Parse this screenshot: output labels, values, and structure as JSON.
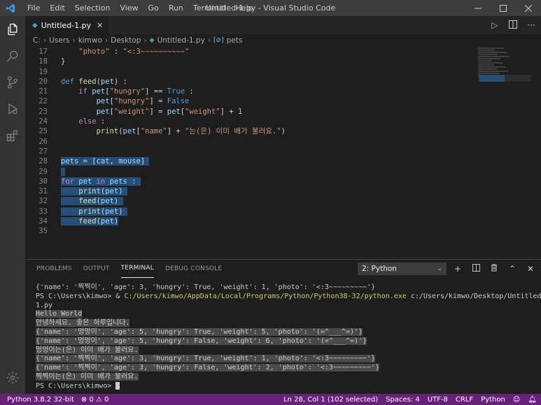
{
  "titlebar": {
    "menu": [
      "File",
      "Edit",
      "Selection",
      "View",
      "Go",
      "Run",
      "Terminal",
      "Help"
    ],
    "window_title": "Untitled-1.py - Visual Studio Code"
  },
  "tab": {
    "label": "Untitled-1.py"
  },
  "breadcrumb": [
    "C:",
    "Users",
    "kimwo",
    "Desktop",
    "Untitled-1.py",
    "pets"
  ],
  "editor": {
    "lines": [
      {
        "n": "17",
        "html": "<span class='st'>    \"photo\"</span> : <span class='st'>\"&lt;:3~~~~~~~~~~\"</span>"
      },
      {
        "n": "18",
        "html": "}"
      },
      {
        "n": "19",
        "html": ""
      },
      {
        "n": "20",
        "html": "<span class='kw'>def</span> <span class='fn'>feed</span>(<span class='var'>pet</span>) :"
      },
      {
        "n": "21",
        "html": "    <span class='kw2'>if</span> <span class='var'>pet</span>[<span class='st'>\"hungry\"</span>] == <span class='kw'>True</span> :"
      },
      {
        "n": "22",
        "html": "        <span class='var'>pet</span>[<span class='st'>\"hungry\"</span>] = <span class='kw'>False</span>"
      },
      {
        "n": "23",
        "html": "        <span class='var'>pet</span>[<span class='st'>\"weight\"</span>] = <span class='var'>pet</span>[<span class='st'>\"weight\"</span>] + <span class='num'>1</span>"
      },
      {
        "n": "24",
        "html": "    <span class='kw2'>else</span> :"
      },
      {
        "n": "25",
        "html": "        <span class='fn'>print</span>(<span class='var'>pet</span>[<span class='st'>\"name\"</span>] + <span class='st'>\"는(은) 이미 배가 불러요.\"</span>)"
      },
      {
        "n": "26",
        "html": ""
      },
      {
        "n": "27",
        "html": ""
      },
      {
        "n": "28",
        "html": "<span class='sel'><span class='var'>pets</span> = [<span class='var'>cat</span>, <span class='var'>mouse</span>] </span>"
      },
      {
        "n": "29",
        "html": "<span class='sel'> </span>"
      },
      {
        "n": "30",
        "html": "<span class='sel'><span class='kw2'>for</span> <span class='var'>pet</span> <span class='kw2'>in</span> <span class='var'>pets</span> : </span>"
      },
      {
        "n": "31",
        "html": "<span class='sel'><span class='ws'>····</span><span class='fn'>print</span>(<span class='var'>pet</span>) </span>"
      },
      {
        "n": "32",
        "html": "<span class='sel'><span class='ws'>····</span><span class='fn'>feed</span>(<span class='var'>pet</span>) </span>"
      },
      {
        "n": "33",
        "html": "<span class='sel'><span class='ws'>····</span><span class='fn'>print</span>(<span class='var'>pet</span>) </span>"
      },
      {
        "n": "34",
        "html": "<span class='sel'><span class='ws'>····</span><span class='fn'>feed</span>(<span class='var'>pet</span>)</span>"
      },
      {
        "n": "35",
        "html": ""
      }
    ]
  },
  "panel": {
    "tabs": [
      "PROBLEMS",
      "OUTPUT",
      "TERMINAL",
      "DEBUG CONSOLE"
    ],
    "active_tab": "TERMINAL",
    "terminal_select": "2: Python"
  },
  "terminal": {
    "lines": [
      {
        "text": "{'name': '찍찍이', 'age': 3, 'hungry': True, 'weight': 1, 'photo': '<:3~~~~~~~~~'}",
        "sel": false
      },
      {
        "prompt": "PS C:\\Users\\kimwo> & ",
        "path": "C:/Users/kimwo/AppData/Local/Programs/Python/Python38-32/python.exe",
        "rest": " c:/Users/kimwo/Desktop/Untitled-",
        "sel": false
      },
      {
        "text": "1.py",
        "sel": false
      },
      {
        "text": "Hello World",
        "sel": true
      },
      {
        "text": "안녕하세요. 좋은 하루입니다.",
        "sel": true
      },
      {
        "text": "{'name': '멍멍이', 'age': 5, 'hungry': True, 'weight': 5, 'photo': '(=^___^=)'}",
        "sel": true
      },
      {
        "text": "{'name': '멍멍이', 'age': 5, 'hungry': False, 'weight': 6, 'photo': '(=^___^=)'}",
        "sel": true
      },
      {
        "text": "멍멍이는(은) 이미 배가 불러요.",
        "sel": true
      },
      {
        "text": "{'name': '찍찍이', 'age': 3, 'hungry': True, 'weight': 1, 'photo': '<:3~~~~~~~~~'}",
        "sel": true
      },
      {
        "text": "{'name': '찍찍이', 'age': 3, 'hungry': False, 'weight': 2, 'photo': '<:3~~~~~~~~~'}",
        "sel": true
      },
      {
        "text": "찍찍이는(은) 이미 배가 불러요.",
        "sel": true
      },
      {
        "text": "PS C:\\Users\\kimwo> ",
        "sel": false,
        "cursor": true
      }
    ]
  },
  "statusbar": {
    "python": "Python 3.8.2 32-bit",
    "errors": "0",
    "warnings": "0",
    "position": "Ln 28, Col 1 (102 selected)",
    "spaces": "Spaces: 4",
    "encoding": "UTF-8",
    "eol": "CRLF",
    "language": "Python"
  },
  "colors": {
    "statusbar": "#68217a",
    "selection": "#264f78",
    "activity_bar": "#333333",
    "title_bar": "#3c3c3c"
  }
}
